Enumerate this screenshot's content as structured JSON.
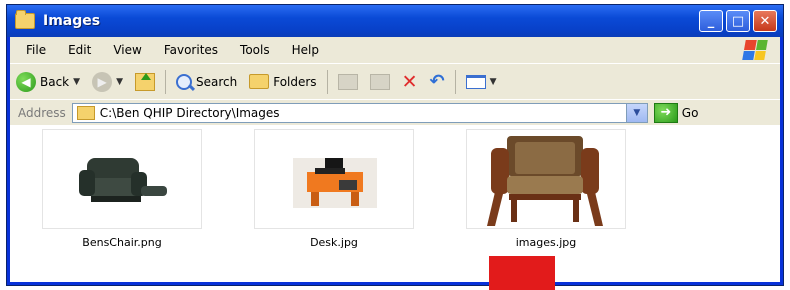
{
  "window": {
    "title": "Images"
  },
  "menu": [
    "File",
    "Edit",
    "View",
    "Favorites",
    "Tools",
    "Help"
  ],
  "toolbar": {
    "back_label": "Back",
    "search_label": "Search",
    "folders_label": "Folders"
  },
  "address": {
    "label": "Address",
    "value": "C:\\Ben QHIP Directory\\Images",
    "go_label": "Go"
  },
  "files": [
    {
      "name": "BensChair.png",
      "icon": "recliner-chair-thumbnail"
    },
    {
      "name": "Desk.jpg",
      "icon": "desk-thumbnail"
    },
    {
      "name": "images.jpg",
      "icon": "wooden-armchair-thumbnail"
    }
  ],
  "colors": {
    "titlebar": "#0a4ad6",
    "chrome": "#ece9d8",
    "overlay": "#e21b1b"
  }
}
